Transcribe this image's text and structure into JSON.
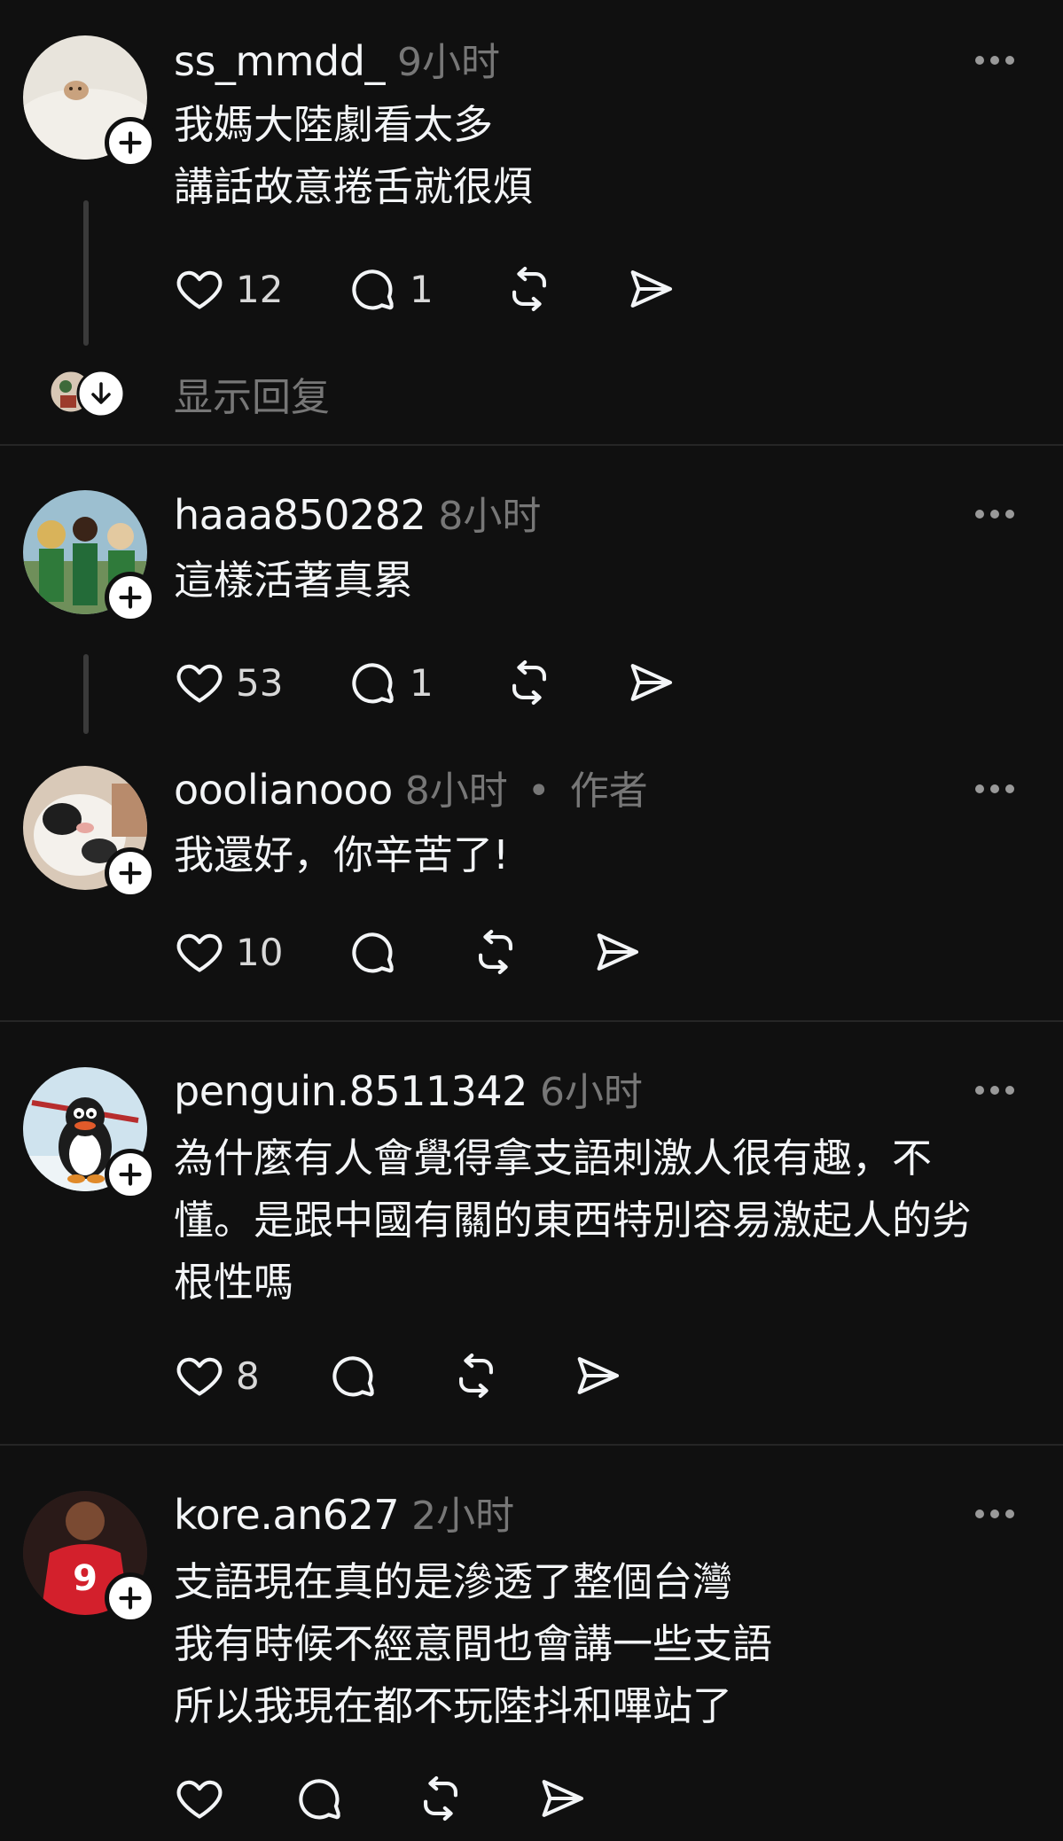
{
  "posts": [
    {
      "username": "ss_mmdd_",
      "time": "9小时",
      "lines": [
        "我媽大陸劇看太多",
        "講話故意捲舌就很煩"
      ],
      "likes": "12",
      "replies": "1",
      "show_replies": "显示回复"
    },
    {
      "username": "haaa850282",
      "time": "8小时",
      "lines": [
        "這樣活著真累"
      ],
      "likes": "53",
      "replies": "1"
    },
    {
      "username": "ooolianooo",
      "time": "8小时",
      "author_tag": "作者",
      "lines": [
        "我還好，你辛苦了!"
      ],
      "likes": "10"
    },
    {
      "username": "penguin.8511342",
      "time": "6小时",
      "lines": [
        "為什麼有人會覺得拿支語刺激人很有趣，不",
        "懂。是跟中國有關的東西特別容易激起人的劣",
        "根性嗎"
      ],
      "likes": "8"
    },
    {
      "username": "kore.an627",
      "time": "2小时",
      "lines": [
        "支語現在真的是滲透了整個台灣",
        "我有時候不經意間也會講一些支語",
        "所以我現在都不玩陸抖和嗶站了"
      ]
    }
  ],
  "jersey_number": "9",
  "colors": {
    "background": "#101010",
    "text": "#f3f5f7",
    "muted": "#777777",
    "divider": "#262626"
  },
  "icons": [
    "heart-icon",
    "comment-icon",
    "repost-icon",
    "share-icon",
    "more-icon",
    "follow-plus-icon",
    "chevron-down-icon"
  ]
}
